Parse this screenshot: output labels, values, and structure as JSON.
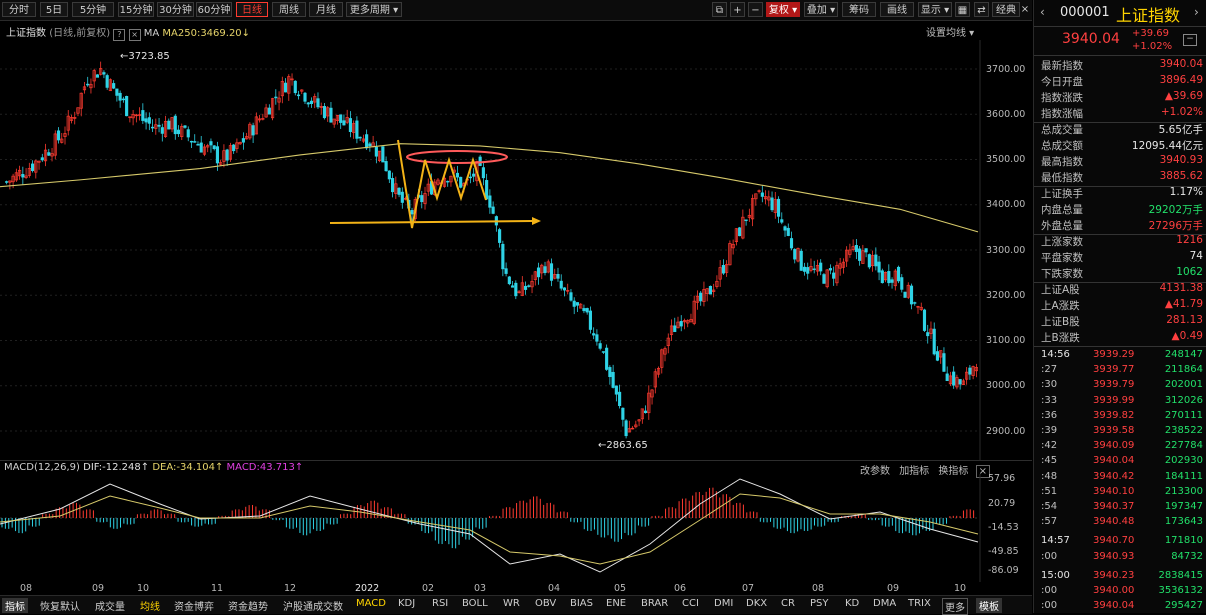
{
  "toolbar": {
    "periods": [
      "分时",
      "5日",
      "5分钟",
      "15分钟",
      "30分钟",
      "60分钟",
      "日线",
      "周线",
      "月线",
      "更多周期 ▾"
    ],
    "active_period": "日线",
    "right_buttons": [
      "复权 ▾",
      "叠加 ▾",
      "筹码",
      "画线",
      "显示 ▾",
      "经典"
    ]
  },
  "chart_header": {
    "index_name": "上证指数",
    "mode": "(日线,前复权)",
    "ma_label": "MA",
    "ma_value": "MA250:3469.20",
    "settings": "设置均线 ▾"
  },
  "annotations": {
    "high": "3723.85",
    "low": "2863.65"
  },
  "chart_data": [
    {
      "type": "candlestick",
      "title": "上证指数 (日线,前复权)",
      "y_ticks": [
        "3700.00",
        "3600.00",
        "3500.00",
        "3400.00",
        "3300.00",
        "3200.00",
        "3100.00",
        "3000.00",
        "2900.00"
      ],
      "ylim": [
        2840,
        3760
      ],
      "x_ticks": [
        "08",
        "09",
        "10",
        "11",
        "12",
        "2022",
        "02",
        "03",
        "04",
        "05",
        "06",
        "07",
        "08",
        "09",
        "10"
      ],
      "overlays": [
        {
          "name": "MA250",
          "last": 3469.2
        }
      ],
      "annotations": [
        {
          "label": "3723.85",
          "value": 3723.85
        },
        {
          "label": "2863.65",
          "value": 2863.65
        }
      ],
      "close_approx": [
        3450,
        3470,
        3490,
        3520,
        3550,
        3600,
        3680,
        3700,
        3650,
        3610,
        3590,
        3570,
        3580,
        3560,
        3540,
        3520,
        3500,
        3520,
        3560,
        3600,
        3640,
        3680,
        3650,
        3620,
        3600,
        3580,
        3560,
        3540,
        3500,
        3420,
        3380,
        3420,
        3460,
        3470,
        3440,
        3480,
        3400,
        3250,
        3200,
        3230,
        3270,
        3220,
        3180,
        3150,
        3100,
        3000,
        2900,
        2920,
        3000,
        3100,
        3150,
        3170,
        3200,
        3250,
        3320,
        3380,
        3420,
        3400,
        3330,
        3270,
        3250,
        3240,
        3270,
        3300,
        3280,
        3240,
        3250,
        3200,
        3150,
        3080,
        3020,
        3000,
        3060
      ]
    },
    {
      "type": "bar",
      "title": "MACD(12,26,9)",
      "series": [
        {
          "name": "DIF",
          "last": -12.248
        },
        {
          "name": "DEA",
          "last": -34.104
        },
        {
          "name": "MACD",
          "last": 43.713
        }
      ],
      "y_ticks": [
        "57.96",
        "20.79",
        "-14.53",
        "-49.85",
        "-86.09"
      ],
      "ylim": [
        -86.09,
        75
      ]
    }
  ],
  "macd_header": {
    "name": "MACD(12,26,9)",
    "dif": "DIF:-12.248↑",
    "dea": "DEA:-34.104↑",
    "macd": "MACD:43.713↑",
    "buttons": [
      "改参数",
      "加指标",
      "换指标"
    ]
  },
  "bottom_tabs": [
    "指标",
    "恢复默认",
    "成交量",
    "均线",
    "资金博弈",
    "资金趋势",
    "沪股通成交数",
    "MACD",
    "KDJ",
    "RSI",
    "BOLL",
    "WR",
    "OBV",
    "BIAS",
    "ENE",
    "BRAR",
    "CCI",
    "DMI",
    "DKX",
    "CR",
    "PSY",
    "KD",
    "DMA",
    "TRIX",
    "更多",
    "模板"
  ],
  "panel": {
    "code": "000001",
    "name": "上证指数",
    "price": "3940.04",
    "change": "+39.69",
    "change_pct": "+1.02%",
    "stats": [
      {
        "label": "最新指数",
        "value": "3940.04",
        "color": "up"
      },
      {
        "label": "今日开盘",
        "value": "3896.49",
        "color": "up"
      },
      {
        "label": "指数涨跌",
        "value": "▲39.69",
        "color": "up"
      },
      {
        "label": "指数涨幅",
        "value": "+1.02%",
        "color": "up"
      },
      {
        "label": "总成交量",
        "value": "5.65亿手",
        "color": "white"
      },
      {
        "label": "总成交额",
        "value": "12095.44亿元",
        "color": "white"
      },
      {
        "label": "最高指数",
        "value": "3940.93",
        "color": "up"
      },
      {
        "label": "最低指数",
        "value": "3885.62",
        "color": "up"
      },
      {
        "label": "上证换手",
        "value": "1.17%",
        "color": "white"
      },
      {
        "label": "内盘总量",
        "value": "29202万手",
        "color": "green"
      },
      {
        "label": "外盘总量",
        "value": "27296万手",
        "color": "up"
      },
      {
        "label": "上涨家数",
        "value": "1216",
        "color": "up"
      },
      {
        "label": "平盘家数",
        "value": "74",
        "color": "white"
      },
      {
        "label": "下跌家数",
        "value": "1062",
        "color": "green"
      },
      {
        "label": "上证A股",
        "value": "4131.38",
        "color": "up"
      },
      {
        "label": "上A涨跌",
        "value": "▲41.79",
        "color": "up"
      },
      {
        "label": "上证B股",
        "value": "281.13",
        "color": "up"
      },
      {
        "label": "上B涨跌",
        "value": "▲0.49",
        "color": "up"
      }
    ],
    "ticks": [
      {
        "t": "14:56",
        "p": "3939.29",
        "q": "248147"
      },
      {
        "t": ":27",
        "p": "3939.77",
        "q": "211864"
      },
      {
        "t": ":30",
        "p": "3939.79",
        "q": "202001"
      },
      {
        "t": ":33",
        "p": "3939.99",
        "q": "312026"
      },
      {
        "t": ":36",
        "p": "3939.82",
        "q": "270111"
      },
      {
        "t": ":39",
        "p": "3939.58",
        "q": "238522"
      },
      {
        "t": ":42",
        "p": "3940.09",
        "q": "227784"
      },
      {
        "t": ":45",
        "p": "3940.04",
        "q": "202930"
      },
      {
        "t": ":48",
        "p": "3940.42",
        "q": "184111"
      },
      {
        "t": ":51",
        "p": "3940.10",
        "q": "213300"
      },
      {
        "t": ":54",
        "p": "3940.37",
        "q": "197347"
      },
      {
        "t": ":57",
        "p": "3940.48",
        "q": "173643"
      },
      {
        "t": "14:57",
        "p": "3940.70",
        "q": "171810"
      },
      {
        "t": ":00",
        "p": "3940.93",
        "q": "84732"
      },
      {
        "t": "15:00",
        "p": "3940.23",
        "q": "2838415"
      },
      {
        "t": ":00",
        "p": "3940.00",
        "q": "3536132"
      },
      {
        "t": ":00",
        "p": "3940.04",
        "q": "295427"
      }
    ]
  }
}
